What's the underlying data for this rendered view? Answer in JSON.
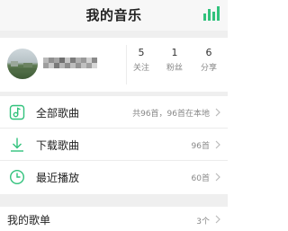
{
  "header": {
    "title": "我的音乐",
    "accent": "#31c27c"
  },
  "profile": {
    "username": "",
    "stats": [
      {
        "value": "5",
        "label": "关注"
      },
      {
        "value": "1",
        "label": "粉丝"
      },
      {
        "value": "6",
        "label": "分享"
      }
    ]
  },
  "list": [
    {
      "icon": "music-note-icon",
      "label": "全部歌曲",
      "meta": "共96首，96首在本地"
    },
    {
      "icon": "download-icon",
      "label": "下载歌曲",
      "meta": "96首"
    },
    {
      "icon": "clock-icon",
      "label": "最近播放",
      "meta": "60首"
    }
  ],
  "playlists": {
    "title": "我的歌单",
    "count": "3个"
  }
}
